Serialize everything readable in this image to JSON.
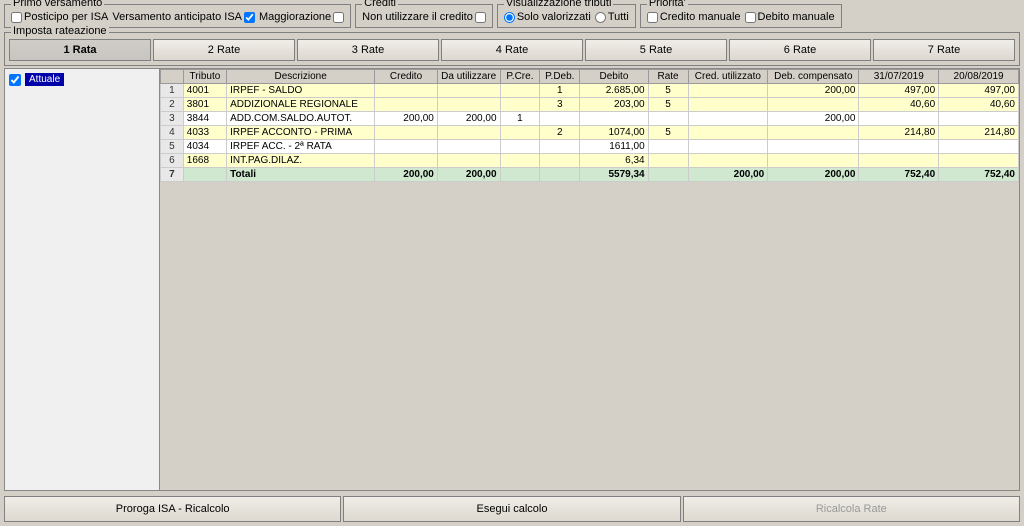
{
  "panels": {
    "primo_versamento": {
      "title": "Primo versamento",
      "posticipo_label": "Posticipo per ISA",
      "versamento_label": "Versamento anticipato ISA",
      "versamento_checked": true,
      "maggiorazione_label": "Maggiorazione",
      "maggiorazione_checked": false
    },
    "crediti": {
      "title": "Crediti",
      "non_utilizzare_label": "Non utilizzare il credito",
      "non_utilizzare_checked": false
    },
    "visualizzazione": {
      "title": "Visualizzazione tributi",
      "solo_valorizzati_label": "Solo valorizzati",
      "tutti_label": "Tutti",
      "selected": "solo_valorizzati"
    },
    "priorita": {
      "title": "Priorita'",
      "credito_manuale_label": "Credito manuale",
      "debito_manuale_label": "Debito manuale"
    }
  },
  "imposta_rateazione": {
    "title": "Imposta rateazione",
    "buttons": [
      {
        "label": "1 Rata",
        "active": true
      },
      {
        "label": "2 Rate",
        "active": false
      },
      {
        "label": "3 Rate",
        "active": false
      },
      {
        "label": "4 Rate",
        "active": false
      },
      {
        "label": "5 Rate",
        "active": false
      },
      {
        "label": "6 Rate",
        "active": false
      },
      {
        "label": "7 Rate",
        "active": false
      }
    ]
  },
  "grid": {
    "side_label": "Attuale",
    "columns": [
      {
        "label": "",
        "key": "idx"
      },
      {
        "label": "Tributo",
        "key": "tributo"
      },
      {
        "label": "Descrizione",
        "key": "descrizione"
      },
      {
        "label": "Credito",
        "key": "credito"
      },
      {
        "label": "Da utilizzare",
        "key": "da_utilizzare"
      },
      {
        "label": "P.Cre.",
        "key": "p_cre"
      },
      {
        "label": "P.Deb.",
        "key": "p_deb"
      },
      {
        "label": "Debito",
        "key": "debito"
      },
      {
        "label": "Rate",
        "key": "rate"
      },
      {
        "label": "Cred. utilizzato",
        "key": "cred_utilizzato"
      },
      {
        "label": "Deb. compensato",
        "key": "deb_compensato"
      },
      {
        "label": "31/07/2019",
        "key": "date1"
      },
      {
        "label": "20/08/2019",
        "key": "date2"
      }
    ],
    "rows": [
      {
        "idx": "1",
        "tributo": "4001",
        "descrizione": "IRPEF - SALDO",
        "credito": "",
        "da_utilizzare": "",
        "p_cre": "",
        "p_deb": "1",
        "debito": "2.685,00",
        "rate": "5",
        "cred_utilizzato": "",
        "deb_compensato": "200,00",
        "date1": "497,00",
        "date2": "497,00",
        "color": "yellow"
      },
      {
        "idx": "2",
        "tributo": "3801",
        "descrizione": "ADDIZIONALE REGIONALE",
        "credito": "",
        "da_utilizzare": "",
        "p_cre": "",
        "p_deb": "3",
        "debito": "203,00",
        "rate": "5",
        "cred_utilizzato": "",
        "deb_compensato": "",
        "date1": "40,60",
        "date2": "40,60",
        "color": "yellow"
      },
      {
        "idx": "3",
        "tributo": "3844",
        "descrizione": "ADD.COM.SALDO.AUTOT.",
        "credito": "200,00",
        "da_utilizzare": "200,00",
        "p_cre": "1",
        "p_deb": "",
        "debito": "",
        "rate": "",
        "cred_utilizzato": "",
        "deb_compensato": "200,00",
        "date1": "",
        "date2": "",
        "color": "white"
      },
      {
        "idx": "4",
        "tributo": "4033",
        "descrizione": "IRPEF ACCONTO - PRIMA",
        "credito": "",
        "da_utilizzare": "",
        "p_cre": "",
        "p_deb": "2",
        "debito": "1074,00",
        "rate": "5",
        "cred_utilizzato": "",
        "deb_compensato": "",
        "date1": "214,80",
        "date2": "214,80",
        "color": "yellow"
      },
      {
        "idx": "5",
        "tributo": "4034",
        "descrizione": "IRPEF ACC. - 2ª RATA",
        "credito": "",
        "da_utilizzare": "",
        "p_cre": "",
        "p_deb": "",
        "debito": "1611,00",
        "rate": "",
        "cred_utilizzato": "",
        "deb_compensato": "",
        "date1": "",
        "date2": "",
        "color": "white"
      },
      {
        "idx": "6",
        "tributo": "1668",
        "descrizione": "INT.PAG.DILAZ.",
        "credito": "",
        "da_utilizzare": "",
        "p_cre": "",
        "p_deb": "",
        "debito": "6,34",
        "rate": "",
        "cred_utilizzato": "",
        "deb_compensato": "",
        "date1": "",
        "date2": "",
        "color": "yellow"
      },
      {
        "idx": "7",
        "tributo": "",
        "descrizione": "Totali",
        "credito": "200,00",
        "da_utilizzare": "200,00",
        "p_cre": "",
        "p_deb": "",
        "debito": "5579,34",
        "rate": "",
        "cred_utilizzato": "200,00",
        "deb_compensato": "200,00",
        "date1": "752,40",
        "date2": "752,40",
        "color": "totals"
      }
    ]
  },
  "bottom_buttons": {
    "proroga": "Proroga ISA - Ricalcolo",
    "esegui": "Esegui calcolo",
    "ricalcola": "Ricalcola Rate"
  }
}
